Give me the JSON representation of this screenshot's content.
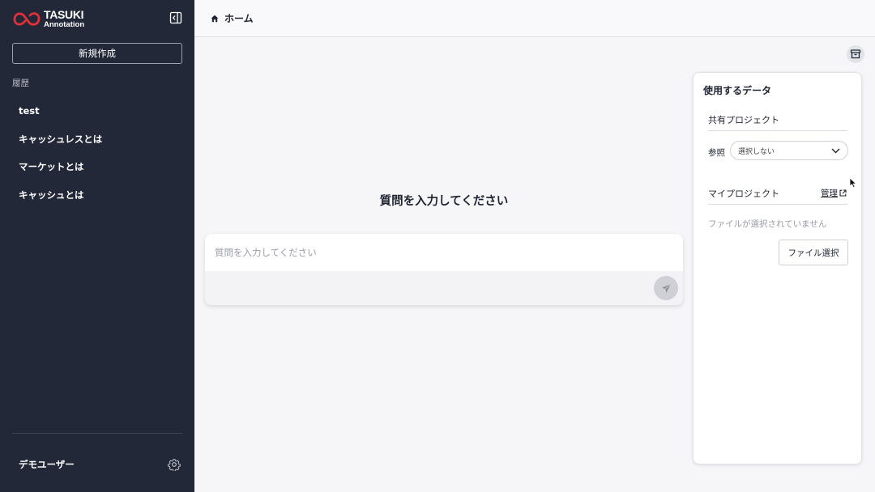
{
  "sidebar": {
    "logo": {
      "title": "TASUKI",
      "subtitle": "Annotation"
    },
    "new_button": "新規作成",
    "history_label": "履歴",
    "history": [
      "test",
      "キャッシュレスとは",
      "マーケットとは",
      "キャッシュとは"
    ],
    "user_name": "デモユーザー"
  },
  "header": {
    "breadcrumb": "ホーム"
  },
  "main": {
    "prompt_title": "質問を入力してください",
    "input_placeholder": "質問を入力してください"
  },
  "data_panel": {
    "title": "使用するデータ",
    "shared_project": "共有プロジェクト",
    "reference_label": "参照",
    "reference_value": "選択しない",
    "my_project": "マイプロジェクト",
    "manage_link": "管理",
    "no_file": "ファイルが選択されていません",
    "file_button": "ファイル選択"
  },
  "colors": {
    "sidebar_bg": "#232838",
    "logo_red": "#e2303b",
    "main_bg": "#f6f6f8"
  },
  "icons": [
    "collapse-sidebar-icon",
    "home-icon",
    "archive-icon",
    "send-icon",
    "chevron-down-icon",
    "external-link-icon",
    "gear-icon"
  ]
}
